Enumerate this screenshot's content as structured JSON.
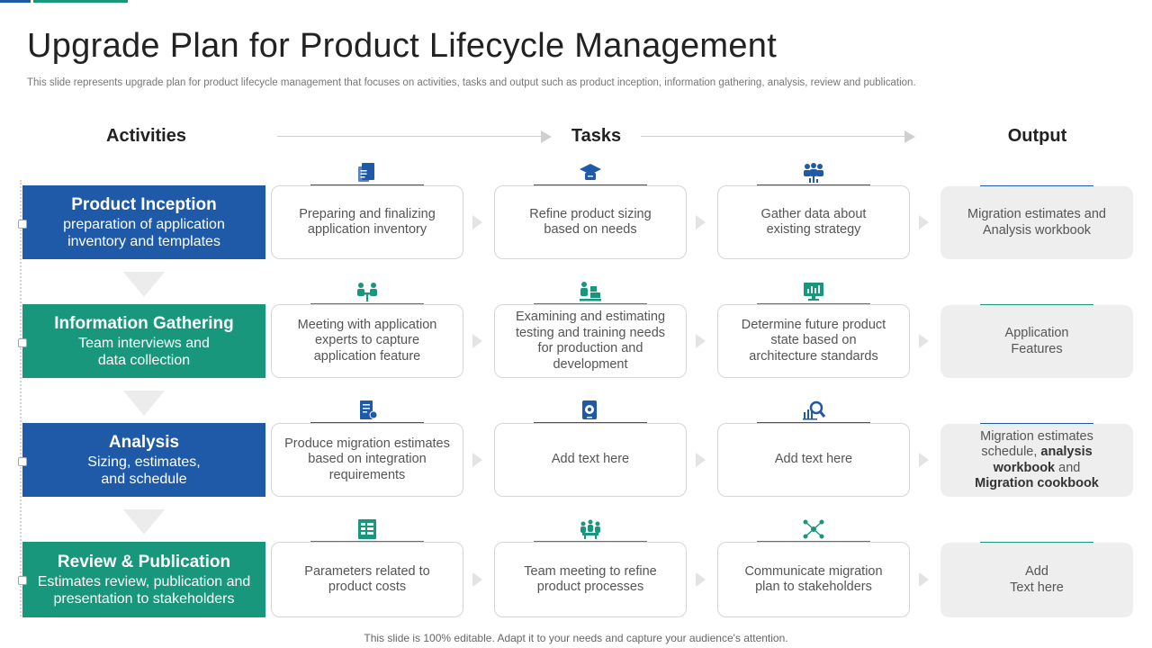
{
  "title": "Upgrade Plan for Product Lifecycle Management",
  "subtitle": "This slide represents upgrade plan for product lifecycle management that focuses on activities, tasks and output such as product inception, information gathering, analysis, review and publication.",
  "headers": {
    "activities": "Activities",
    "tasks": "Tasks",
    "output": "Output"
  },
  "colors": {
    "blue": "#1f5aa8",
    "green": "#18977c"
  },
  "rows": [
    {
      "activity_title": "Product Inception",
      "activity_desc": [
        "preparation of application",
        "inventory  and templates"
      ],
      "tasks": [
        {
          "icon": "clipboard-document-icon",
          "lines": [
            "Preparing and finalizing",
            "application inventory"
          ]
        },
        {
          "icon": "graduation-cap-icon",
          "lines": [
            "Refine product sizing",
            "based on needs"
          ]
        },
        {
          "icon": "team-chart-icon",
          "lines": [
            "Gather data about",
            "existing strategy"
          ]
        }
      ],
      "output_lines": [
        "Migration estimates and",
        "Analysis workbook"
      ]
    },
    {
      "activity_title": "Information Gathering",
      "activity_desc": [
        "Team interviews and",
        "data collection"
      ],
      "tasks": [
        {
          "icon": "meeting-table-icon",
          "lines": [
            "Meeting with application",
            "experts to capture",
            "application feature"
          ]
        },
        {
          "icon": "worker-boxes-icon",
          "lines": [
            "Examining and estimating",
            "testing and training needs",
            "for production and",
            "development"
          ]
        },
        {
          "icon": "monitor-chart-icon",
          "lines": [
            "Determine future product",
            "state based on",
            "architecture standards"
          ]
        }
      ],
      "output_lines": [
        "Application",
        "Features"
      ]
    },
    {
      "activity_title": "Analysis",
      "activity_desc": [
        "Sizing, estimates,",
        "and schedule"
      ],
      "tasks": [
        {
          "icon": "report-document-icon",
          "lines": [
            "Produce migration estimates",
            "based on integration",
            "requirements"
          ]
        },
        {
          "icon": "tablet-gear-icon",
          "lines": [
            "Add text here"
          ]
        },
        {
          "icon": "magnifier-chart-icon",
          "lines": [
            "Add text here"
          ]
        }
      ],
      "output_segments": [
        {
          "text": "Migration estimates",
          "bold": false
        },
        {
          "text": "schedule, ",
          "bold": false
        },
        {
          "text": "analysis",
          "bold": true
        },
        {
          "text": "workbook",
          "bold": true
        },
        {
          "text": " and",
          "bold": false
        },
        {
          "text": "Migration cookbook",
          "bold": true
        }
      ]
    },
    {
      "activity_title": "Review & Publication",
      "activity_desc": [
        "Estimates review, publication and",
        "presentation to stakeholders"
      ],
      "tasks": [
        {
          "icon": "spreadsheet-icon",
          "lines": [
            "Parameters related to",
            "product costs"
          ]
        },
        {
          "icon": "team-meeting-icon",
          "lines": [
            "Team meeting to refine",
            "product processes"
          ]
        },
        {
          "icon": "network-people-icon",
          "lines": [
            "Communicate migration",
            "plan to stakeholders"
          ]
        }
      ],
      "output_lines": [
        "Add",
        "Text here"
      ]
    }
  ],
  "footer": "This slide is 100% editable. Adapt it to your needs and capture your audience's attention."
}
